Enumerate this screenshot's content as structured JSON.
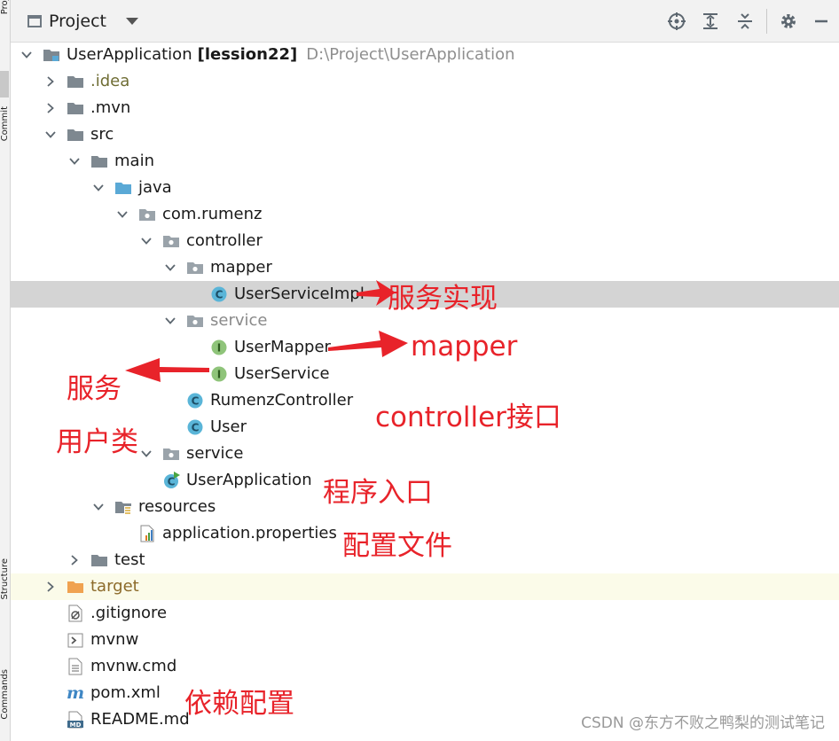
{
  "side_tabs": {
    "top": "Project",
    "mid": "Commit",
    "bottom_a": "Structure",
    "bottom_b": "Commands"
  },
  "toolbar": {
    "title": "Project",
    "buttons": [
      {
        "name": "select-opened-file",
        "icon": "crosshair-icon"
      },
      {
        "name": "expand-all",
        "icon": "expand-all-icon"
      },
      {
        "name": "collapse-all",
        "icon": "collapse-all-icon"
      },
      {
        "name": "settings",
        "icon": "gear-icon"
      },
      {
        "name": "hide",
        "icon": "minimize-icon"
      }
    ]
  },
  "tree": [
    {
      "label": "UserApplication",
      "extra": "[lession22]",
      "path": "D:\\Project\\UserApplication",
      "depth": 0,
      "arrow": "down",
      "icon": "module-folder-icon"
    },
    {
      "label": ".idea",
      "depth": 1,
      "arrow": "right",
      "icon": "folder-icon",
      "color": "olive"
    },
    {
      "label": ".mvn",
      "depth": 1,
      "arrow": "right",
      "icon": "folder-icon"
    },
    {
      "label": "src",
      "depth": 1,
      "arrow": "down",
      "icon": "folder-icon"
    },
    {
      "label": "main",
      "depth": 2,
      "arrow": "down",
      "icon": "folder-icon"
    },
    {
      "label": "java",
      "depth": 3,
      "arrow": "down",
      "icon": "source-folder-icon"
    },
    {
      "label": "com.rumenz",
      "depth": 4,
      "arrow": "down",
      "icon": "package-icon"
    },
    {
      "label": "controller",
      "depth": 5,
      "arrow": "down",
      "icon": "package-icon"
    },
    {
      "label": "mapper",
      "depth": 6,
      "arrow": "down",
      "icon": "package-icon"
    },
    {
      "label": "UserServiceImpl",
      "depth": 7,
      "arrow": "none",
      "icon": "class-icon",
      "selected": true
    },
    {
      "label": "service",
      "depth": 6,
      "arrow": "down",
      "icon": "package-icon",
      "color": "muted"
    },
    {
      "label": "UserMapper",
      "depth": 7,
      "arrow": "none",
      "icon": "interface-icon"
    },
    {
      "label": "UserService",
      "depth": 7,
      "arrow": "none",
      "icon": "interface-icon"
    },
    {
      "label": "RumenzController",
      "depth": 6,
      "arrow": "none",
      "icon": "class-icon"
    },
    {
      "label": "User",
      "depth": 6,
      "arrow": "none",
      "icon": "class-icon"
    },
    {
      "label": "service",
      "depth": 5,
      "arrow": "down",
      "icon": "package-icon"
    },
    {
      "label": "UserApplication",
      "depth": 5,
      "arrow": "none",
      "icon": "spring-class-icon"
    },
    {
      "label": "resources",
      "depth": 3,
      "arrow": "down",
      "icon": "resources-folder-icon"
    },
    {
      "label": "application.properties",
      "depth": 4,
      "arrow": "none",
      "icon": "properties-file-icon"
    },
    {
      "label": "test",
      "depth": 2,
      "arrow": "right",
      "icon": "folder-icon"
    },
    {
      "label": "target",
      "depth": 1,
      "arrow": "right",
      "icon": "excluded-folder-icon",
      "color": "orange",
      "excluded": true
    },
    {
      "label": ".gitignore",
      "depth": 1,
      "arrow": "none",
      "icon": "gitignore-icon"
    },
    {
      "label": "mvnw",
      "depth": 1,
      "arrow": "none",
      "icon": "shell-icon"
    },
    {
      "label": "mvnw.cmd",
      "depth": 1,
      "arrow": "none",
      "icon": "text-file-icon"
    },
    {
      "label": "pom.xml",
      "depth": 1,
      "arrow": "none",
      "icon": "maven-icon"
    },
    {
      "label": "README.md",
      "depth": 1,
      "arrow": "none",
      "icon": "markdown-icon"
    }
  ],
  "annotations": {
    "service_impl": "服务实现",
    "mapper": "mapper",
    "service": "服务",
    "controller": "controller接口",
    "user_class": "用户类",
    "entry": "程序入口",
    "config": "配置文件",
    "deps": "依赖配置"
  },
  "watermark": "CSDN @东方不败之鸭梨的测试笔记",
  "colors": {
    "annotation": "#e8232a",
    "selection": "#d4d4d4",
    "excluded_row": "#fbfbe9",
    "class_icon": "#5ab5d8",
    "interface_icon": "#7fb86a",
    "folder": "#7e8890",
    "source_folder": "#5aa9d6",
    "excluded_folder": "#f0a250"
  }
}
